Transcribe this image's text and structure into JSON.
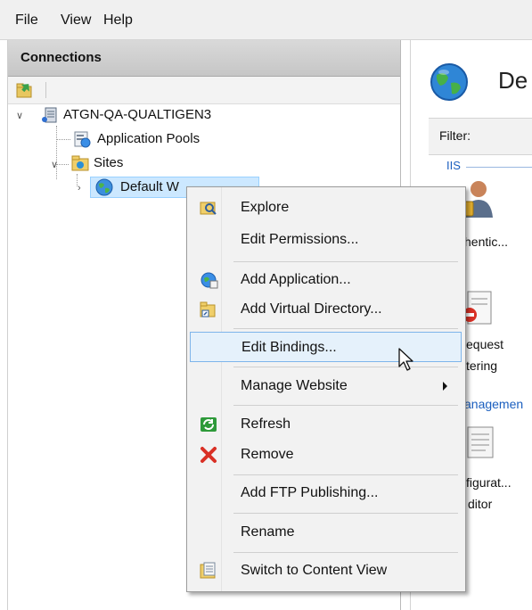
{
  "menubar": {
    "file": "File",
    "view": "View",
    "help": "Help"
  },
  "connections": {
    "header": "Connections",
    "tree": {
      "server": "ATGN-QA-QUALTIGEN3",
      "app_pools": "Application Pools",
      "sites": "Sites",
      "default_site": "Default W"
    }
  },
  "right_pane": {
    "title": "De",
    "filter_label": "Filter:",
    "group_iis": "IIS",
    "feature_auth": "hentic...",
    "feature_req_1": "equest",
    "feature_req_2": "tering",
    "group_management": "anagemen",
    "feature_cfg_1": "figurat...",
    "feature_cfg_2": "ditor"
  },
  "context_menu": {
    "explore": "Explore",
    "edit_permissions": "Edit Permissions...",
    "add_application": "Add Application...",
    "add_virtual_directory": "Add Virtual Directory...",
    "edit_bindings": "Edit Bindings...",
    "manage_website": "Manage Website",
    "refresh": "Refresh",
    "remove": "Remove",
    "add_ftp_publishing": "Add FTP Publishing...",
    "rename": "Rename",
    "switch_to_content_view": "Switch to Content View"
  },
  "colors": {
    "selection_bg": "#cce8ff",
    "highlight_border": "#7eb4ea",
    "remove_red": "#d93025",
    "refresh_green": "#2e9a3a",
    "link_blue": "#1b5fbf"
  }
}
